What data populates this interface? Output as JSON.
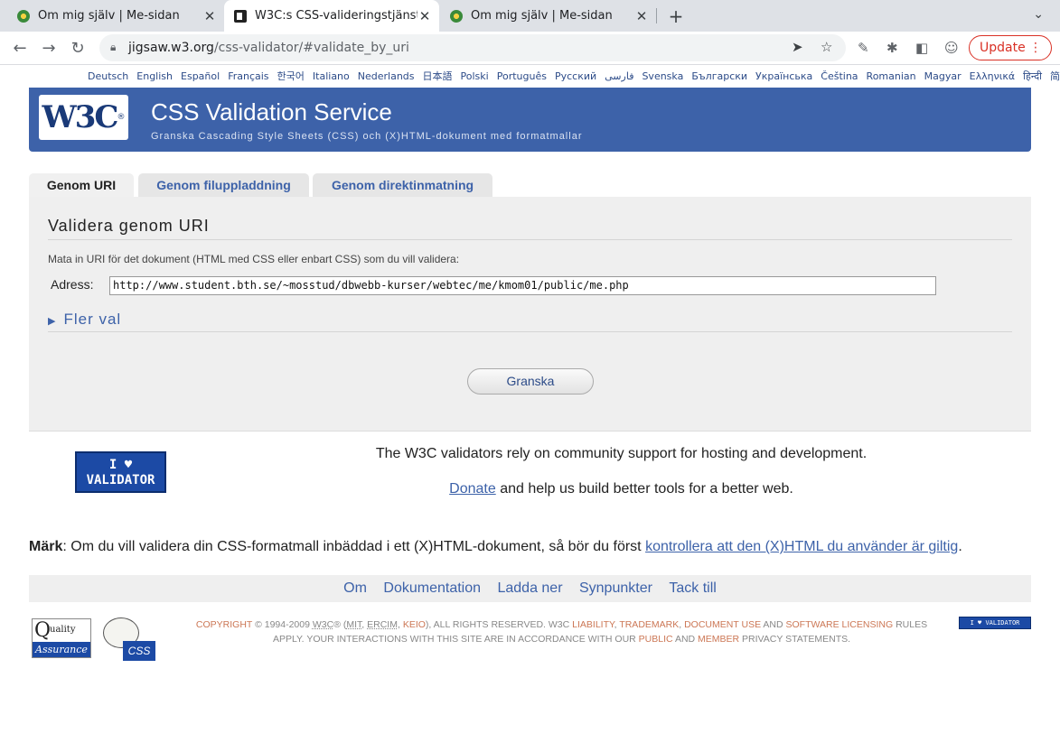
{
  "browser": {
    "tabs": [
      {
        "title": "Om mig själv | Me-sidan",
        "active": false
      },
      {
        "title": "W3C:s CSS-valideringstjänst",
        "active": true
      },
      {
        "title": "Om mig själv | Me-sidan",
        "active": false
      }
    ],
    "url_domain": "jigsaw.w3.org",
    "url_path": "/css-validator/#validate_by_uri",
    "update_label": "Update"
  },
  "languages": [
    "Deutsch",
    "English",
    "Español",
    "Français",
    "한국어",
    "Italiano",
    "Nederlands",
    "日本語",
    "Polski",
    "Português",
    "Русский",
    "فارسی",
    "Svenska",
    "Български",
    "Українська",
    "Čeština",
    "Romanian",
    "Magyar",
    "Ελληνικά",
    "हिन्दी",
    "简体中文"
  ],
  "banner": {
    "logo": "W3C",
    "title": "CSS Validation Service",
    "subtitle": "Granska Cascading Style Sheets (CSS) och (X)HTML-dokument med formatmallar"
  },
  "tabs": [
    "Genom URI",
    "Genom filuppladdning",
    "Genom direktinmatning"
  ],
  "form": {
    "heading": "Validera genom URI",
    "hint": "Mata in URI för det dokument (HTML med CSS eller enbart CSS) som du vill validera:",
    "address_label": "Adress:",
    "address_value": "http://www.student.bth.se/~mosstud/dbwebb-kurser/webtec/me/kmom01/public/me.php",
    "more_options": "Fler val",
    "submit": "Granska"
  },
  "badge_text": [
    "I ♥",
    "VALIDATOR"
  ],
  "support": {
    "line1": "The W3C validators rely on community support for hosting and development.",
    "donate": "Donate",
    "line2": "and help us build better tools for a better web."
  },
  "note": {
    "bold": "Märk",
    "text": ": Om du vill validera din CSS-formatmall inbäddad i ett (X)HTML-dokument, så bör du först",
    "link": "kontrollera att den (X)HTML du använder är giltig",
    "end": "."
  },
  "footer_nav": [
    "Om",
    "Dokumentation",
    "Ladda ner",
    "Synpunkter",
    "Tack till"
  ],
  "copyright": {
    "p1": "COPYRIGHT",
    "p2": "© 1994-2009",
    "w3c": "W3C",
    "p3": "® (",
    "mit": "MIT",
    "ercim": "ERCIM",
    "keio": "KEIO",
    "p4": "), ALL RIGHTS RESERVED. W3C",
    "liability": "LIABILITY",
    "trademark": "TRADEMARK",
    "docuse": "DOCUMENT USE",
    "and1": "AND",
    "software": "SOFTWARE LICENSING",
    "p5": "RULES APPLY. YOUR INTERACTIONS WITH THIS SITE ARE IN ACCORDANCE WITH OUR",
    "public": "PUBLIC",
    "and2": "AND",
    "member": "MEMBER",
    "p6": "PRIVACY STATEMENTS."
  },
  "qa_logo": {
    "q": "Q",
    "uality": "uality",
    "assurance": "Assurance"
  },
  "css_logo": "CSS",
  "mini_badge": "I ♥ VALIDATOR"
}
